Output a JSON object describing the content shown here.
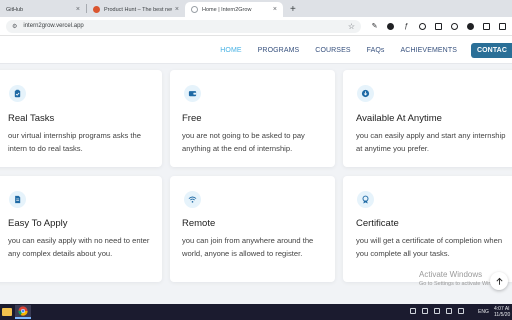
{
  "browser": {
    "tabs": [
      {
        "title": "GitHub",
        "close": "×"
      },
      {
        "title": "Product Hunt – The best new ...",
        "close": "×"
      },
      {
        "title": "Home | Intern2Grow",
        "close": "×"
      }
    ],
    "new_tab": "+",
    "url": "intern2grow.vercel.app",
    "star": "☆"
  },
  "site": {
    "nav": [
      "HOME",
      "PROGRAMS",
      "COURSES",
      "FAQs",
      "ACHIEVEMENTS"
    ],
    "contact_label": "CONTAC",
    "accent_color": "#47b2e4",
    "nav_color": "#37517e"
  },
  "cards": [
    {
      "icon": "clipboard-icon",
      "title": "Real Tasks",
      "text": "our virtual internship programs asks the intern to do real tasks."
    },
    {
      "icon": "wallet-icon",
      "title": "Free",
      "text": "you are not going to be asked to pay anything at the end of internship."
    },
    {
      "icon": "download-icon",
      "title": "Available At Anytime",
      "text": "you can easily apply and start any internship at anytime you prefer."
    },
    {
      "icon": "document-icon",
      "title": "Easy To Apply",
      "text": "you can easily apply with no need to enter any complex details about you."
    },
    {
      "icon": "wifi-icon",
      "title": "Remote",
      "text": "you can join from anywhere around the world, anyone is allowed to register."
    },
    {
      "icon": "award-icon",
      "title": "Certificate",
      "text": "you will get a certificate of completion when you complete all your tasks."
    }
  ],
  "watermark": {
    "line1": "Activate Windows",
    "line2": "Go to Settings to activate Windows."
  },
  "taskbar": {
    "lang": "ENG",
    "time": "4:07 AI",
    "date": "11/5/20"
  }
}
